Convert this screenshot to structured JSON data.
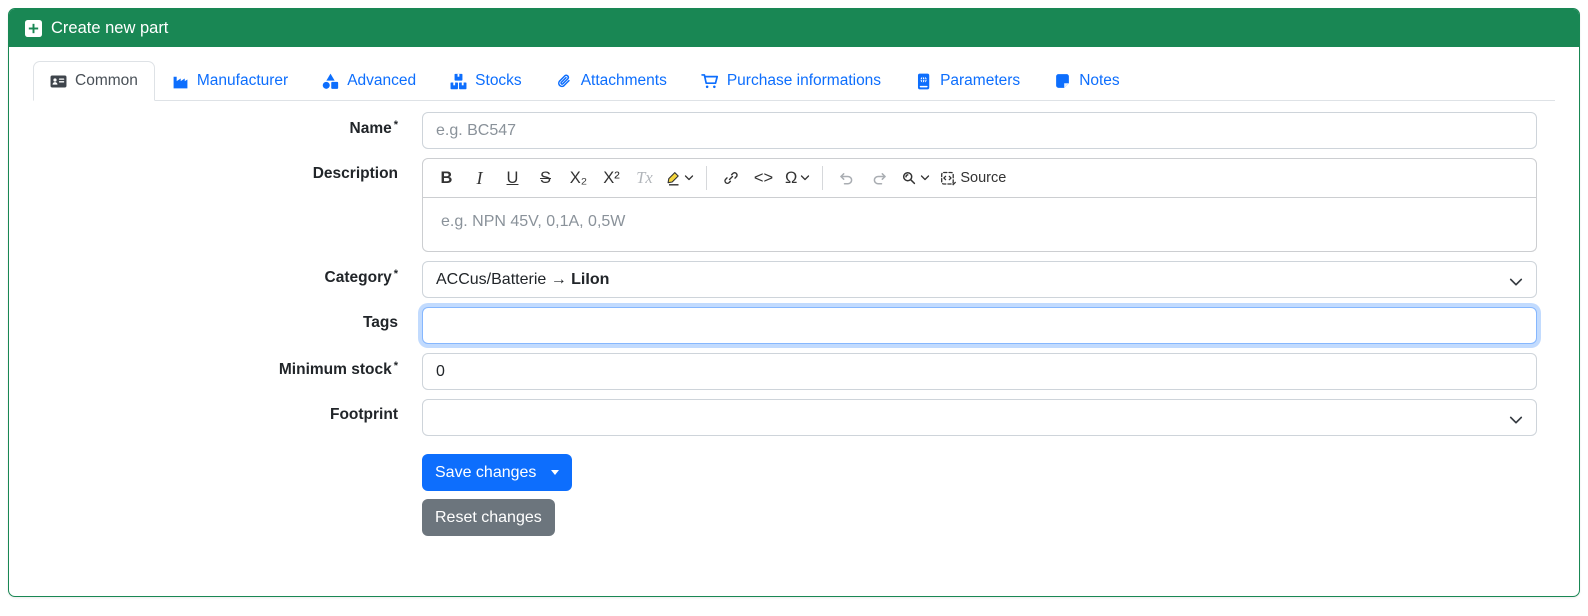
{
  "header": {
    "title": "Create new part",
    "icon": "plus-square-icon"
  },
  "tabs": [
    {
      "label": "Common",
      "icon": "id-card-icon",
      "active": true
    },
    {
      "label": "Manufacturer",
      "icon": "factory-icon",
      "active": false
    },
    {
      "label": "Advanced",
      "icon": "shapes-icon",
      "active": false
    },
    {
      "label": "Stocks",
      "icon": "boxes-icon",
      "active": false
    },
    {
      "label": "Attachments",
      "icon": "paperclip-icon",
      "active": false
    },
    {
      "label": "Purchase informations",
      "icon": "cart-icon",
      "active": false
    },
    {
      "label": "Parameters",
      "icon": "book-icon",
      "active": false
    },
    {
      "label": "Notes",
      "icon": "sticky-note-icon",
      "active": false
    }
  ],
  "form": {
    "name": {
      "label": "Name",
      "required_marker": "*",
      "placeholder": "e.g. BC547",
      "value": ""
    },
    "description": {
      "label": "Description",
      "placeholder": "e.g. NPN 45V, 0,1A, 0,5W"
    },
    "category": {
      "label": "Category",
      "required_marker": "*",
      "value_prefix": "ACCus/Batterie → ",
      "value_bold": "LiIon"
    },
    "tags": {
      "label": "Tags",
      "value": "",
      "focused": true
    },
    "minimum_stock": {
      "label": "Minimum stock",
      "required_marker": "*",
      "value": "0"
    },
    "footprint": {
      "label": "Footprint",
      "value": ""
    }
  },
  "editor": {
    "toolbar": {
      "bold": "B",
      "italic": "I",
      "underline": "U",
      "strikethrough": "S",
      "subscript": "X₂",
      "superscript": "X²",
      "remove_format": "Tx",
      "code": "<>",
      "special_character": "Ω",
      "source_label": "Source"
    }
  },
  "actions": {
    "save_label": "Save changes",
    "reset_label": "Reset changes"
  },
  "colors": {
    "header_green": "#198754",
    "accent_blue": "#0d6efd",
    "secondary_gray": "#6c757d",
    "focus_ring": "rgba(13,110,253,.25)"
  }
}
